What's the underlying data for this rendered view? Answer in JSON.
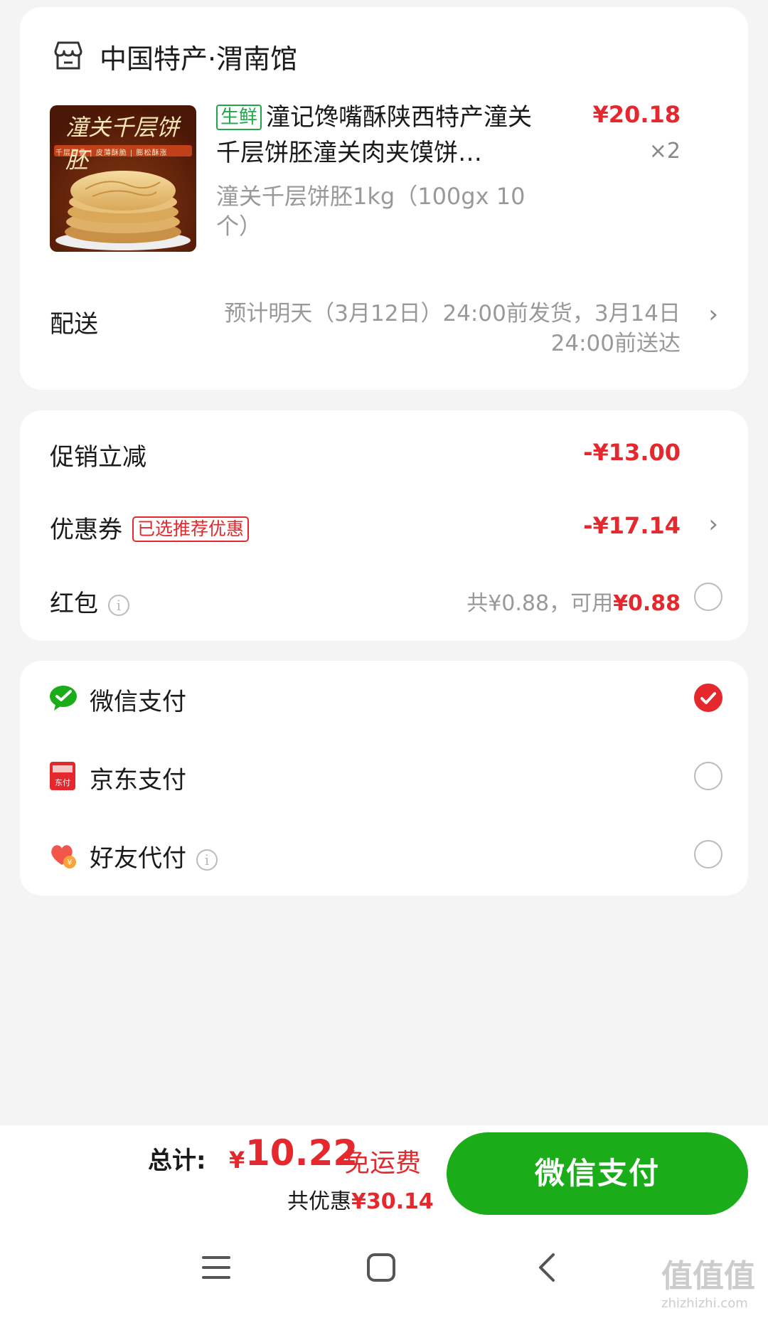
{
  "store": {
    "name": "中国特产·渭南馆",
    "icon": "store-icon"
  },
  "product": {
    "thumb_title": "潼关千层饼胚",
    "thumb_subtitle": "千层百叠 | 皮薄酥脆 | 膨松酥涨",
    "tag": "生鲜",
    "name": "潼记馋嘴酥陕西特产潼关千层饼胚潼关肉夹馍饼…",
    "price": "¥20.18",
    "quantity": "×2",
    "spec": "潼关千层饼胚1kg（100gx 10个）"
  },
  "delivery": {
    "label": "配送",
    "text": "预计明天（3月12日）24:00前发货，3月14日24:00前送达"
  },
  "discounts": {
    "promo_label": "促销立减",
    "promo_value": "-¥13.00",
    "coupon_label": "优惠券",
    "coupon_badge": "已选推荐优惠",
    "coupon_value": "-¥17.14",
    "redpacket_label": "红包",
    "redpacket_total": "共¥0.88，可用",
    "redpacket_available": "¥0.88"
  },
  "payment_methods": [
    {
      "label": "微信支付",
      "icon": "wechat-icon",
      "selected": true
    },
    {
      "label": "京东支付",
      "icon": "jd-pay-icon",
      "selected": false
    },
    {
      "label": "好友代付",
      "icon": "friend-pay-heart-icon",
      "selected": false
    }
  ],
  "footer": {
    "total_label": "总计:",
    "currency": "¥",
    "total_amount": "10.22",
    "free_shipping": "免运费",
    "saved_label": "共优惠",
    "saved_value": "¥30.14",
    "pay_button": "微信支付"
  },
  "watermark": {
    "text": "值值值",
    "sub": "zhizhizhi.com"
  },
  "colors": {
    "accent_red": "#e4282e",
    "wechat_green": "#1aad19",
    "fresh_green": "#21a64a"
  }
}
